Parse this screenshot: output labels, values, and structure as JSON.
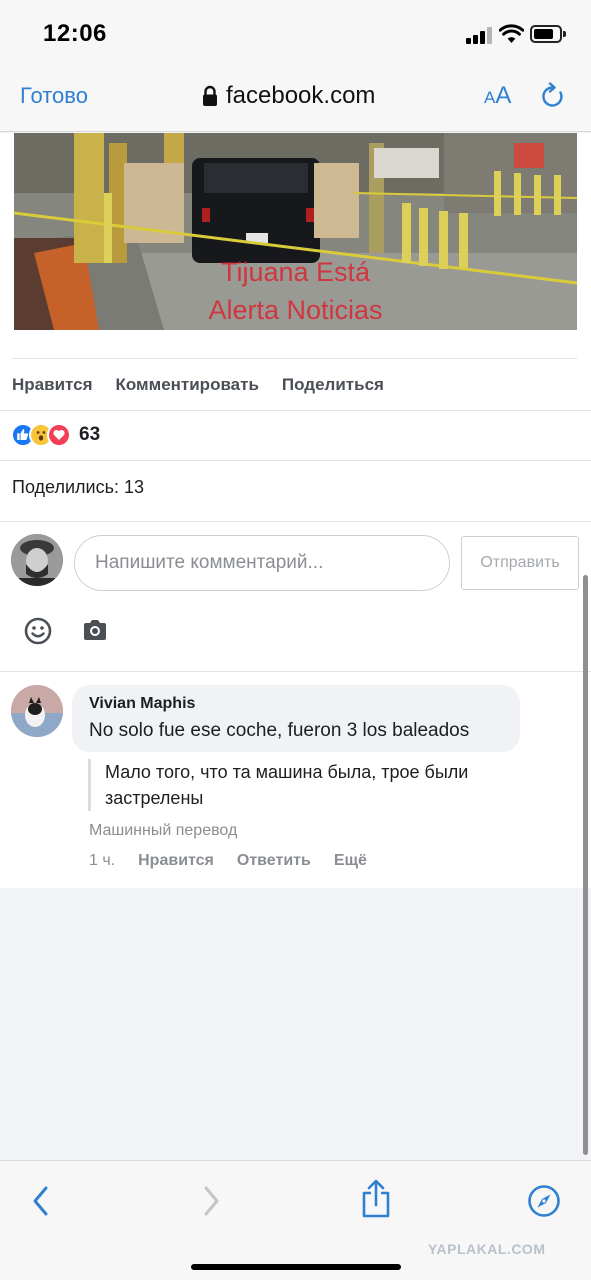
{
  "status_bar": {
    "time": "12:06"
  },
  "browser": {
    "done_label": "Готово",
    "url": "facebook.com",
    "aa_small": "A",
    "aa_big": "A"
  },
  "post": {
    "image_watermark": [
      "Tijuana Está",
      "Alerta Noticias"
    ],
    "actions": {
      "like": "Нравится",
      "comment": "Комментировать",
      "share": "Поделиться"
    },
    "reactions_count": "63",
    "shares": "Поделились: 13"
  },
  "composer": {
    "placeholder": "Напишите комментарий...",
    "send_label": "Отправить"
  },
  "comment": {
    "author": "Vivian Maphis",
    "text": "No solo fue ese coche, fueron 3 los baleados",
    "translation": "Мало того, что та машина была, трое были застрелены",
    "translation_label": "Машинный перевод",
    "time": "1 ч.",
    "like": "Нравится",
    "reply": "Ответить",
    "more": "Ещё"
  },
  "footer": {
    "watermark": "YAPLAKAL.COM"
  },
  "colors": {
    "link_blue": "#2f80d1",
    "facebook_blue": "#1877f2"
  },
  "icons": [
    "lock-icon",
    "reload-icon",
    "like-icon",
    "wow-icon",
    "love-icon",
    "emoji-icon",
    "camera-icon",
    "back-icon",
    "forward-icon",
    "share-icon",
    "compass-icon"
  ]
}
